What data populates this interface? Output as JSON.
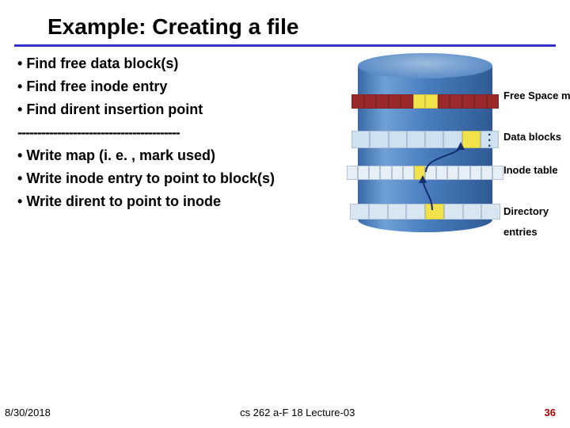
{
  "title": "Example: Creating a file",
  "bullets": {
    "b1": "Find free data block(s)",
    "b2": "Find free inode entry",
    "b3": "Find dirent insertion point",
    "divider": "-----------------------------------------",
    "b4": "Write map (i. e. , mark used)",
    "b5": "Write inode entry to point to block(s)",
    "b6": "Write dirent to point to inode"
  },
  "diagram": {
    "free_space_map": "Free Space map",
    "data_blocks": "Data blocks",
    "inode_table": "Inode table",
    "directory": "Directory",
    "entries": "entries",
    "dots": "…"
  },
  "footer": {
    "date": "8/30/2018",
    "center": "cs 262 a-F 18 Lecture-03",
    "page": "36"
  }
}
